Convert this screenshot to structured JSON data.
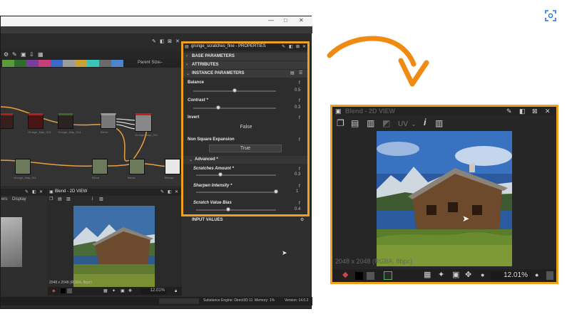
{
  "app": {
    "window_controls": {
      "minimize": "—",
      "maximize": "□",
      "close": "✕"
    },
    "graph": {
      "parent_size_label": "Parent Size:",
      "parent_size_value": "--",
      "nodes": [
        {
          "label": "Grunge_Map_013"
        },
        {
          "label": "Grunge_Map_014"
        },
        {
          "label": "Grunge_Map_001"
        },
        {
          "label": "Blend"
        },
        {
          "label": "Grunge_Map_011"
        },
        {
          "label": "Blend"
        },
        {
          "label": "Blend"
        },
        {
          "label": "Bitmap"
        }
      ]
    },
    "properties": {
      "title": "grunge_scratches_fine - PROPERTIES",
      "sections": {
        "base": "BASE PARAMETERS",
        "attributes": "ATTRIBUTES",
        "instance": "INSTANCE PARAMETERS",
        "advanced": "Advanced *",
        "input_values": "INPUT VALUES"
      },
      "params": {
        "balance": {
          "label": "Balance",
          "value": "0.5",
          "level": 0.5
        },
        "contrast": {
          "label": "Contrast *",
          "value": "0.3",
          "level": 0.3
        },
        "invert": {
          "label": "Invert",
          "value": "False"
        },
        "nsq": {
          "label": "Non Square Expansion",
          "value": "True"
        },
        "scratches_amount": {
          "label": "Scratches Amount *",
          "value": "0.3",
          "level": 0.3
        },
        "sharpen": {
          "label": "Sharpen Intensity *",
          "value": "1",
          "level": 1.0
        },
        "bias": {
          "label": "Scratch Value Bias",
          "value": "0.4",
          "level": 0.4
        }
      }
    },
    "small_view": {
      "title": "Blend - 2D VIEW",
      "resolution": "2048 x 2048 (RGBA, 8bpc)",
      "zoom": "12.01%"
    },
    "left_panel": {
      "tab_a": "ers",
      "tab_b": "Display"
    },
    "status": {
      "engine": "Substance Engine: Direct3D 11",
      "memory": "Memory: 1%",
      "version": "Version: 14.0.2"
    }
  },
  "big_view": {
    "title": "Blend - 2D VIEW",
    "uv_label": "UV",
    "resolution": "2048 x 2048 (RGBA, 8bpc)",
    "zoom": "12.01%"
  },
  "colors": {
    "accent": "#f0a020",
    "panel": "#2d2d2d",
    "graph_bg": "#333333"
  }
}
